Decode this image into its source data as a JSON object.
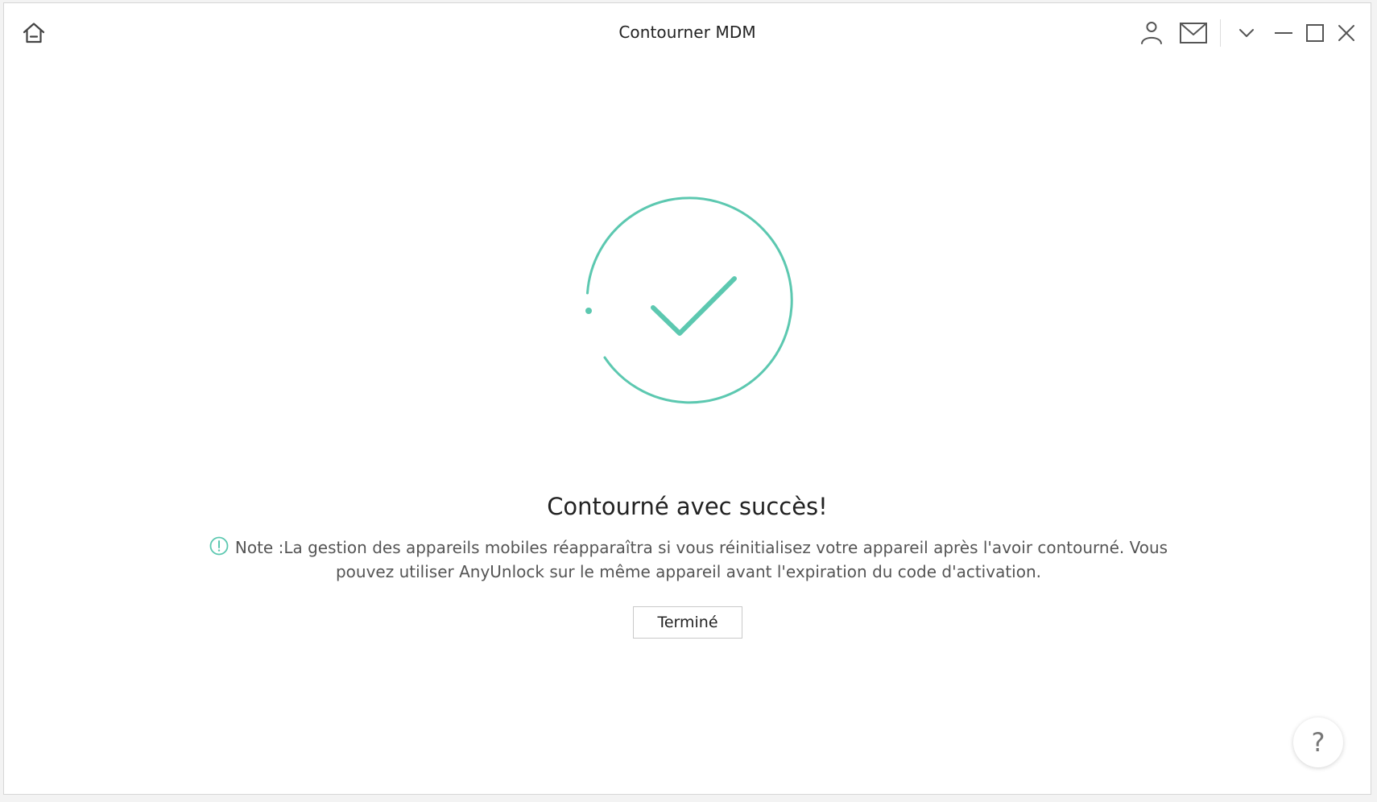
{
  "window": {
    "title": "Contourner MDM"
  },
  "titlebar_icons": {
    "home": "home-icon",
    "user": "user-icon",
    "mail": "mail-icon",
    "dropdown": "chevron-down-icon",
    "minimize": "minimize-icon",
    "maximize": "maximize-icon",
    "close": "close-icon"
  },
  "main": {
    "headline": "Contourné avec succès!",
    "note_prefix": "Note :",
    "note_text": "La gestion des appareils mobiles réapparaîtra si vous réinitialisez votre appareil après l'avoir contourné. Vous pouvez utiliser AnyUnlock sur le même appareil avant l'expiration du code d'activation.",
    "done_label": "Terminé"
  },
  "help": {
    "label": "?"
  },
  "colors": {
    "accent": "#5cc8b0",
    "text": "#222222",
    "note_text": "#555555"
  }
}
